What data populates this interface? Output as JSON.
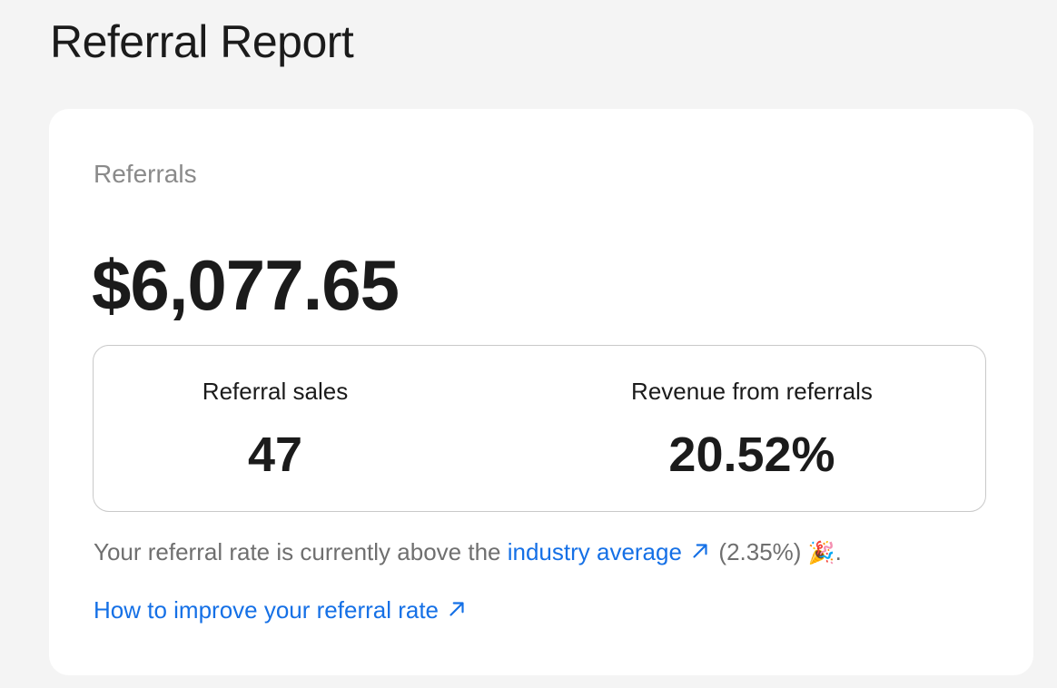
{
  "page": {
    "title": "Referral Report"
  },
  "card": {
    "label": "Referrals",
    "total": "$6,077.65",
    "stats": [
      {
        "label": "Referral sales",
        "value": "47"
      },
      {
        "label": "Revenue from referrals",
        "value": "20.52%"
      }
    ],
    "note": {
      "prefix": "Your referral rate is currently above the ",
      "link_text": "industry average",
      "suffix_value": " (2.35%) ",
      "emoji": "🎉",
      "end": "."
    },
    "improve_link": "How to improve your referral rate"
  },
  "icons": {
    "external_link": "arrow-up-right-icon",
    "celebration": "party-popper-icon"
  },
  "colors": {
    "background": "#f4f4f4",
    "card": "#ffffff",
    "link": "#1570e6",
    "muted_text": "#8a8a8a",
    "border": "#c9c9c9"
  }
}
